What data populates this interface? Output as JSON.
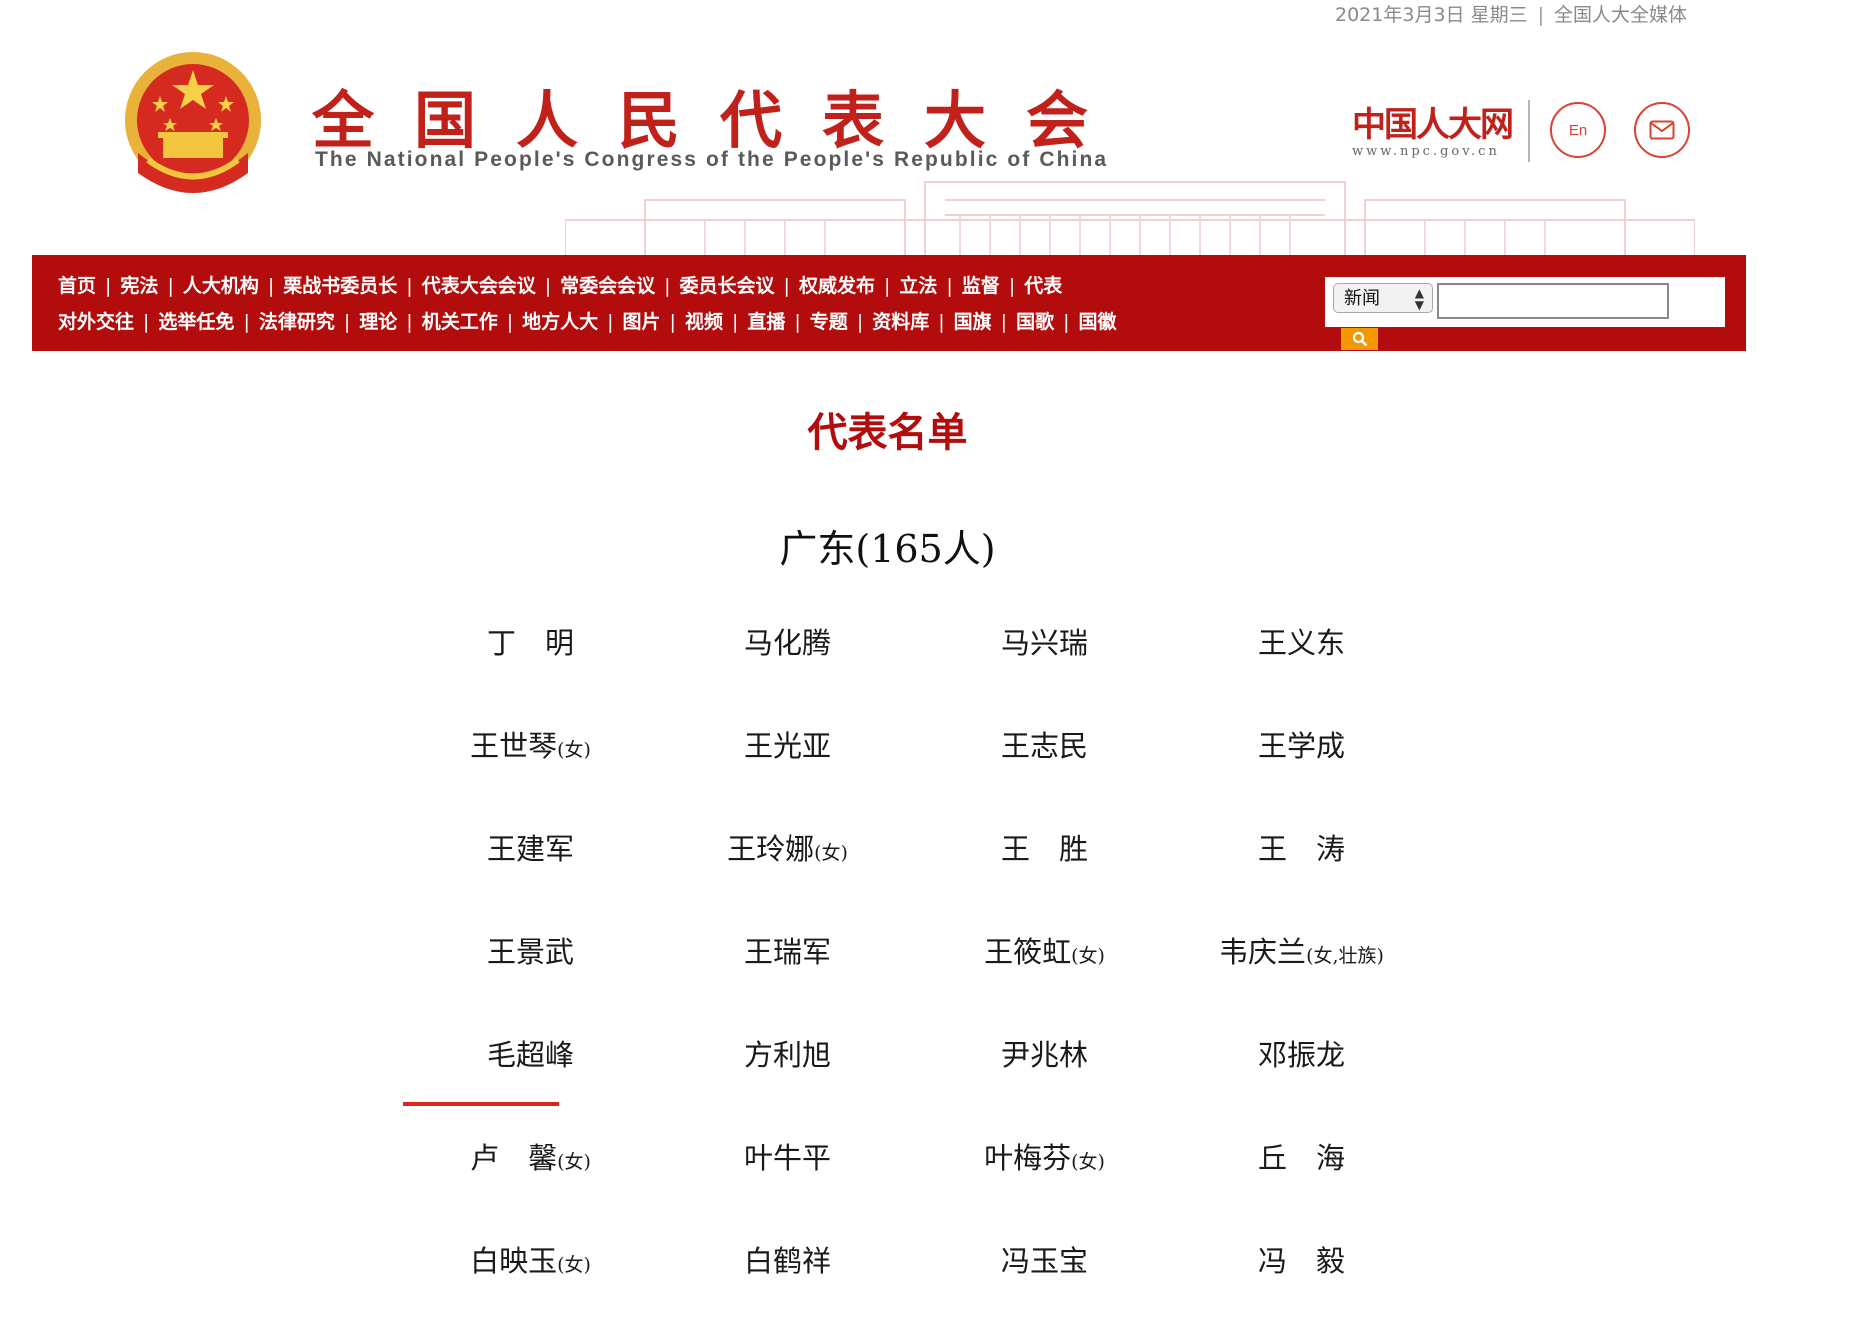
{
  "topbar": {
    "date": "2021年3月3日 星期三",
    "separator": "|",
    "media_link": "全国人大全媒体"
  },
  "header": {
    "title_cn": "全国人民代表大会",
    "title_en": "The National People's Congress of the People's Republic of China",
    "site_logo": "中国人大网",
    "site_url": "www.npc.gov.cn",
    "lang_button": "En",
    "mail_icon": "mail-icon"
  },
  "nav": {
    "row1": [
      "首页",
      "宪法",
      "人大机构",
      "栗战书委员长",
      "代表大会会议",
      "常委会会议",
      "委员长会议",
      "权威发布",
      "立法",
      "监督",
      "代表"
    ],
    "row2": [
      "对外交往",
      "选举任免",
      "法律研究",
      "理论",
      "机关工作",
      "地方人大",
      "图片",
      "视频",
      "直播",
      "专题",
      "资料库",
      "国旗",
      "国歌",
      "国徽"
    ],
    "separator": "|"
  },
  "search": {
    "select_value": "新闻",
    "input_value": "",
    "button_icon": "search-icon"
  },
  "content": {
    "page_title": "代表名单",
    "province_heading": "广东(165人)",
    "rows": [
      [
        {
          "name": "丁　明",
          "note": ""
        },
        {
          "name": "马化腾",
          "note": ""
        },
        {
          "name": "马兴瑞",
          "note": ""
        },
        {
          "name": "王义东",
          "note": ""
        }
      ],
      [
        {
          "name": "王世琴",
          "note": "(女)"
        },
        {
          "name": "王光亚",
          "note": ""
        },
        {
          "name": "王志民",
          "note": ""
        },
        {
          "name": "王学成",
          "note": ""
        }
      ],
      [
        {
          "name": "王建军",
          "note": ""
        },
        {
          "name": "王玲娜",
          "note": "(女)"
        },
        {
          "name": "王　胜",
          "note": ""
        },
        {
          "name": "王　涛",
          "note": ""
        }
      ],
      [
        {
          "name": "王景武",
          "note": ""
        },
        {
          "name": "王瑞军",
          "note": ""
        },
        {
          "name": "王筱虹",
          "note": "(女)"
        },
        {
          "name": "韦庆兰",
          "note": "(女,壮族)"
        }
      ],
      [
        {
          "name": "毛超峰",
          "note": ""
        },
        {
          "name": "方利旭",
          "note": ""
        },
        {
          "name": "尹兆林",
          "note": ""
        },
        {
          "name": "邓振龙",
          "note": ""
        }
      ],
      [
        {
          "name": "卢　馨",
          "note": "(女)"
        },
        {
          "name": "叶牛平",
          "note": ""
        },
        {
          "name": "叶梅芬",
          "note": "(女)"
        },
        {
          "name": "丘　海",
          "note": ""
        }
      ],
      [
        {
          "name": "白映玉",
          "note": "(女)"
        },
        {
          "name": "白鹤祥",
          "note": ""
        },
        {
          "name": "冯玉宝",
          "note": ""
        },
        {
          "name": "冯　毅",
          "note": ""
        }
      ]
    ],
    "hovered_name": "毛超峰"
  }
}
